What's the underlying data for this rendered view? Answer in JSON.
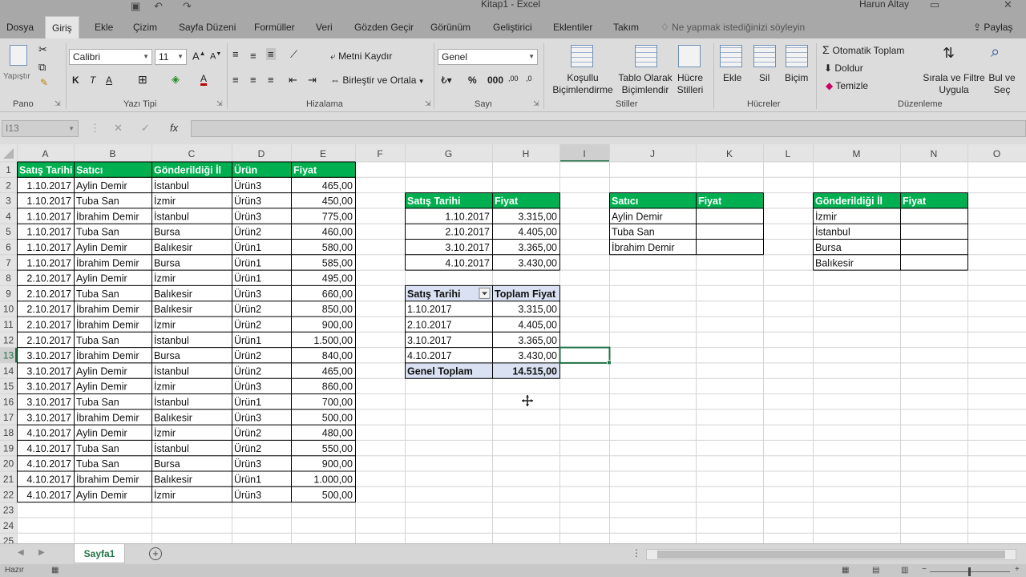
{
  "window": {
    "title": "Kitap1  -  Excel",
    "user": "Harun Altay",
    "share_label": "Paylaş",
    "tell_me_placeholder": "Ne yapmak istediğinizi söyleyin"
  },
  "tabs": [
    "Dosya",
    "Giriş",
    "Ekle",
    "Çizim",
    "Sayfa Düzeni",
    "Formüller",
    "Veri",
    "Gözden Geçir",
    "Görünüm",
    "Geliştirici",
    "Eklentiler",
    "Takım"
  ],
  "active_tab": "Giriş",
  "ribbon": {
    "paste_label": "Yapıştır",
    "font_name": "Calibri",
    "font_size": "11",
    "wrap_text": "Metni Kaydır",
    "merge_center": "Birleştir ve Ortala",
    "number_format": "Genel",
    "cond_format": [
      "Koşullu",
      "Biçimlendirme"
    ],
    "format_table": [
      "Tablo Olarak",
      "Biçimlendir"
    ],
    "cell_styles": [
      "Hücre",
      "Stilleri"
    ],
    "insert": "Ekle",
    "delete": "Sil",
    "format": "Biçim",
    "autosum": "Otomatik Toplam",
    "fill": "Doldur",
    "clear": "Temizle",
    "sort_filter": [
      "Sırala ve Filtre",
      "Uygula"
    ],
    "find_select": [
      "Bul ve",
      "Seç"
    ],
    "groups": [
      "Pano",
      "Yazı Tipi",
      "Hizalama",
      "Sayı",
      "Stiller",
      "Hücreler",
      "Düzenleme"
    ]
  },
  "name_box": "I13",
  "columns": [
    "A",
    "B",
    "C",
    "D",
    "E",
    "F",
    "G",
    "H",
    "I",
    "J",
    "K",
    "L",
    "M",
    "N",
    "O"
  ],
  "selected_column": "I",
  "selected_row": 13,
  "main_table": {
    "headers": [
      "Satış Tarihi",
      "Satıcı",
      "Gönderildiği İl",
      "Ürün",
      "Fiyat"
    ],
    "rows": [
      [
        "1.10.2017",
        "Aylin Demir",
        "İstanbul",
        "Ürün3",
        "465,00"
      ],
      [
        "1.10.2017",
        "Tuba San",
        "İzmir",
        "Ürün3",
        "450,00"
      ],
      [
        "1.10.2017",
        "İbrahim Demir",
        "İstanbul",
        "Ürün3",
        "775,00"
      ],
      [
        "1.10.2017",
        "Tuba San",
        "Bursa",
        "Ürün2",
        "460,00"
      ],
      [
        "1.10.2017",
        "Aylin Demir",
        "Balıkesir",
        "Ürün1",
        "580,00"
      ],
      [
        "1.10.2017",
        "İbrahim Demir",
        "Bursa",
        "Ürün1",
        "585,00"
      ],
      [
        "2.10.2017",
        "Aylin Demir",
        "İzmir",
        "Ürün1",
        "495,00"
      ],
      [
        "2.10.2017",
        "Tuba San",
        "Balıkesir",
        "Ürün3",
        "660,00"
      ],
      [
        "2.10.2017",
        "İbrahim Demir",
        "Balıkesir",
        "Ürün2",
        "850,00"
      ],
      [
        "2.10.2017",
        "İbrahim Demir",
        "İzmir",
        "Ürün2",
        "900,00"
      ],
      [
        "2.10.2017",
        "Tuba San",
        "İstanbul",
        "Ürün1",
        "1.500,00"
      ],
      [
        "3.10.2017",
        "İbrahim Demir",
        "Bursa",
        "Ürün2",
        "840,00"
      ],
      [
        "3.10.2017",
        "Aylin Demir",
        "İstanbul",
        "Ürün2",
        "465,00"
      ],
      [
        "3.10.2017",
        "Aylin Demir",
        "İzmir",
        "Ürün3",
        "860,00"
      ],
      [
        "3.10.2017",
        "Tuba San",
        "İstanbul",
        "Ürün1",
        "700,00"
      ],
      [
        "3.10.2017",
        "İbrahim Demir",
        "Balıkesir",
        "Ürün3",
        "500,00"
      ],
      [
        "4.10.2017",
        "Aylin Demir",
        "İzmir",
        "Ürün2",
        "480,00"
      ],
      [
        "4.10.2017",
        "Tuba San",
        "İstanbul",
        "Ürün2",
        "550,00"
      ],
      [
        "4.10.2017",
        "Tuba San",
        "Bursa",
        "Ürün3",
        "900,00"
      ],
      [
        "4.10.2017",
        "İbrahim Demir",
        "Balıkesir",
        "Ürün1",
        "1.000,00"
      ],
      [
        "4.10.2017",
        "Aylin Demir",
        "İzmir",
        "Ürün3",
        "500,00"
      ]
    ]
  },
  "date_summary": {
    "headers": [
      "Satış Tarihi",
      "Fiyat"
    ],
    "rows": [
      [
        "1.10.2017",
        "3.315,00"
      ],
      [
        "2.10.2017",
        "4.405,00"
      ],
      [
        "3.10.2017",
        "3.365,00"
      ],
      [
        "4.10.2017",
        "3.430,00"
      ]
    ]
  },
  "pivot": {
    "headers": [
      "Satış Tarihi",
      "Toplam Fiyat"
    ],
    "rows": [
      [
        "1.10.2017",
        "3.315,00"
      ],
      [
        "2.10.2017",
        "4.405,00"
      ],
      [
        "3.10.2017",
        "3.365,00"
      ],
      [
        "4.10.2017",
        "3.430,00"
      ]
    ],
    "total": [
      "Genel Toplam",
      "14.515,00"
    ]
  },
  "seller_table": {
    "headers": [
      "Satıcı",
      "Fiyat"
    ],
    "rows": [
      [
        "Aylin Demir",
        ""
      ],
      [
        "Tuba San",
        ""
      ],
      [
        "İbrahim Demir",
        ""
      ]
    ]
  },
  "city_table": {
    "headers": [
      "Gönderildiği İl",
      "Fiyat"
    ],
    "rows": [
      [
        "İzmir",
        ""
      ],
      [
        "İstanbul",
        ""
      ],
      [
        "Bursa",
        ""
      ],
      [
        "Balıkesir",
        ""
      ]
    ]
  },
  "sheet_tab": "Sayfa1",
  "status": "Hazır",
  "colors": {
    "header_green": "#00b050",
    "pivot_header": "#d9e1f2",
    "selection": "#217346",
    "grid": "#d4d4d4"
  }
}
